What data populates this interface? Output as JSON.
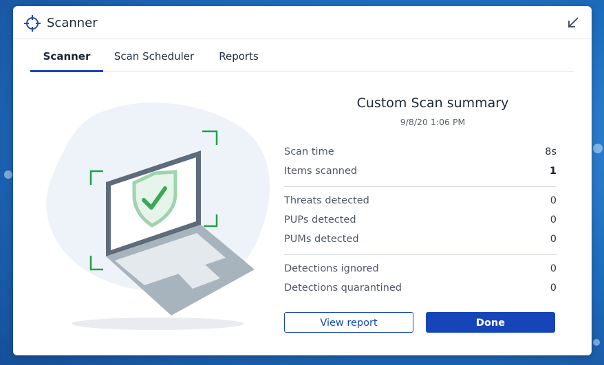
{
  "window": {
    "title": "Scanner",
    "app_icon": "crosshair-icon",
    "collapse_icon": "collapse-arrow-icon"
  },
  "tabs": [
    {
      "label": "Scanner",
      "active": true
    },
    {
      "label": "Scan Scheduler",
      "active": false
    },
    {
      "label": "Reports",
      "active": false
    }
  ],
  "summary": {
    "title": "Custom Scan summary",
    "date": "9/8/20 1:06 PM",
    "group1": [
      {
        "label": "Scan time",
        "value": "8s"
      },
      {
        "label": "Items scanned",
        "value": "1"
      }
    ],
    "group2": [
      {
        "label": "Threats detected",
        "value": "0"
      },
      {
        "label": "PUPs detected",
        "value": "0"
      },
      {
        "label": "PUMs detected",
        "value": "0"
      }
    ],
    "group3": [
      {
        "label": "Detections ignored",
        "value": "0"
      },
      {
        "label": "Detections quarantined",
        "value": "0"
      }
    ]
  },
  "buttons": {
    "view_report": "View report",
    "done": "Done"
  },
  "colors": {
    "accent": "#1545b8",
    "shield_green": "#3aa85a",
    "scan_bracket_green": "#1fa046"
  },
  "illustration": {
    "subject": "laptop-with-shield-check-icon"
  }
}
